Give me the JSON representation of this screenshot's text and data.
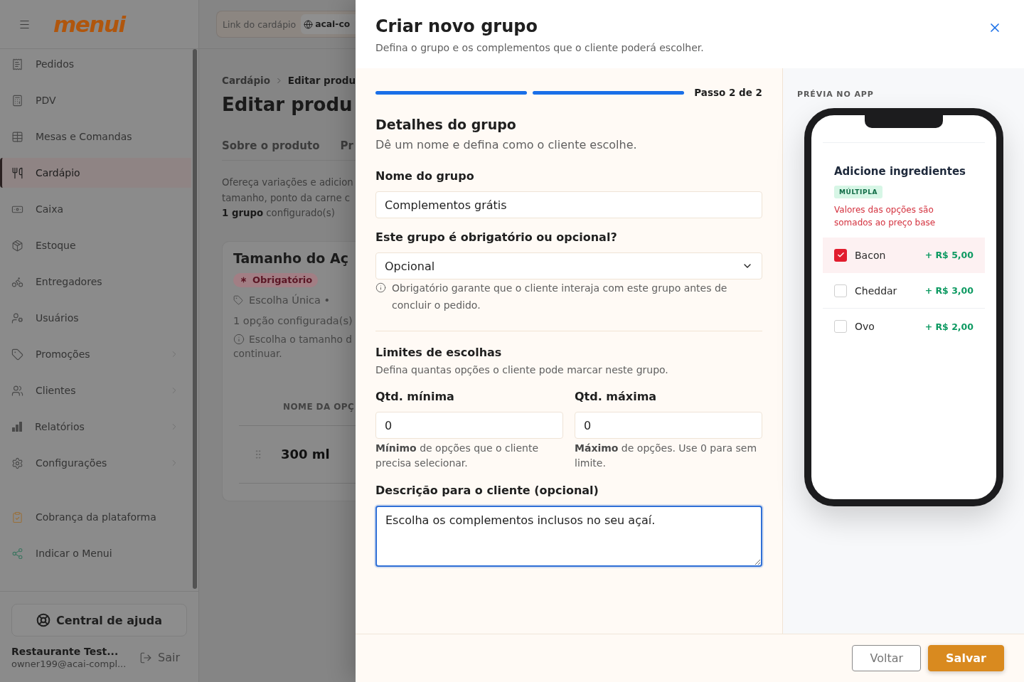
{
  "sidebar": {
    "logo": "menui",
    "nav_items": [
      {
        "label": "Pedidos",
        "selected": false,
        "expandable": false
      },
      {
        "label": "PDV",
        "selected": false,
        "expandable": false
      },
      {
        "label": "Mesas e Comandas",
        "selected": false,
        "expandable": false
      },
      {
        "label": "Cardápio",
        "selected": true,
        "expandable": false
      },
      {
        "label": "Caixa",
        "selected": false,
        "expandable": false
      },
      {
        "label": "Estoque",
        "selected": false,
        "expandable": false
      },
      {
        "label": "Entregadores",
        "selected": false,
        "expandable": false
      },
      {
        "label": "Usuários",
        "selected": false,
        "expandable": false
      },
      {
        "label": "Promoções",
        "selected": false,
        "expandable": true
      },
      {
        "label": "Clientes",
        "selected": false,
        "expandable": true
      },
      {
        "label": "Relatórios",
        "selected": false,
        "expandable": true
      },
      {
        "label": "Configurações",
        "selected": false,
        "expandable": true
      }
    ],
    "extra_items": [
      {
        "label": "Cobrança da plataforma"
      },
      {
        "label": "Indicar o Menui"
      }
    ],
    "help_button": "Central de ajuda",
    "user": {
      "name": "Restaurante Test...",
      "email": "owner199@acai-compl..."
    },
    "logout": "Sair"
  },
  "page": {
    "menu_link": {
      "label": "Link do cardápio",
      "value": "acai-co"
    },
    "breadcrumb": [
      "Cardápio",
      "Editar produ"
    ],
    "title": "Editar produ",
    "tabs": [
      {
        "label": "Sobre o produto",
        "selected": false
      },
      {
        "label": "Pr",
        "selected": false
      }
    ],
    "intro_lines": [
      "Ofereça variações e adicion",
      "tamanho, ponto da carne c"
    ],
    "group_count": "**1 grupo** configurado(s)",
    "group_card": {
      "title": "Tamanho do Aç",
      "badge": "Obrigatório",
      "choice_type": "Escolha Única •",
      "options_count": "1 opção configurada(s)",
      "hint_lines": [
        "Escolha o tamanho d",
        "continuar."
      ],
      "table": {
        "columns": [
          "NOME DA OPÇ"
        ],
        "rows": [
          [
            "300 ml"
          ]
        ]
      }
    }
  },
  "modal": {
    "title": "Criar novo grupo",
    "subtitle": "Defina o grupo e os complementos que o cliente poderá escolher.",
    "progress": {
      "steps": [
        {
          "completed": true
        },
        {
          "completed": true
        }
      ],
      "label": "Passo 2 de 2"
    },
    "section": {
      "title": "Detalhes do grupo",
      "subtitle": "Dê um nome e defina como o cliente escolhe."
    },
    "name_field": {
      "label": "Nome do grupo",
      "value": "Complementos grátis"
    },
    "required_field": {
      "label": "Este grupo é obrigatório ou opcional?",
      "value": "Opcional",
      "hint": "Obrigatório garante que o cliente interaja com este grupo antes de concluir o pedido."
    },
    "limits": {
      "title": "Limites de escolhas",
      "subtitle": "Defina quantas opções o cliente pode marcar neste grupo.",
      "fields": [
        {
          "label": "Qtd. mínima",
          "value": "0",
          "hint": "**Mínimo** de opções que o cliente precisa selecionar."
        },
        {
          "label": "Qtd. máxima",
          "value": "0",
          "hint": "**Máximo** de opções. Use 0 para sem limite."
        }
      ]
    },
    "description_field": {
      "label": "Descrição para o cliente (opcional)",
      "value": "Escolha os complementos inclusos no seu açaí.",
      "focused": true
    },
    "preview": {
      "label": "PRÉVIA NO APP",
      "group_title": "Adicione ingredientes",
      "badge": "MÚLTIPLA",
      "note": "Valores das opções são somados ao preço base",
      "options": [
        {
          "name": "Bacon",
          "price": "+ R$ 5,00",
          "checked": true
        },
        {
          "name": "Cheddar",
          "price": "+ R$ 3,00",
          "checked": false
        },
        {
          "name": "Ovo",
          "price": "+ R$ 2,00",
          "checked": false
        }
      ]
    },
    "buttons": [
      {
        "label": "Voltar",
        "kind": "secondary"
      },
      {
        "label": "Salvar",
        "kind": "primary"
      }
    ]
  }
}
